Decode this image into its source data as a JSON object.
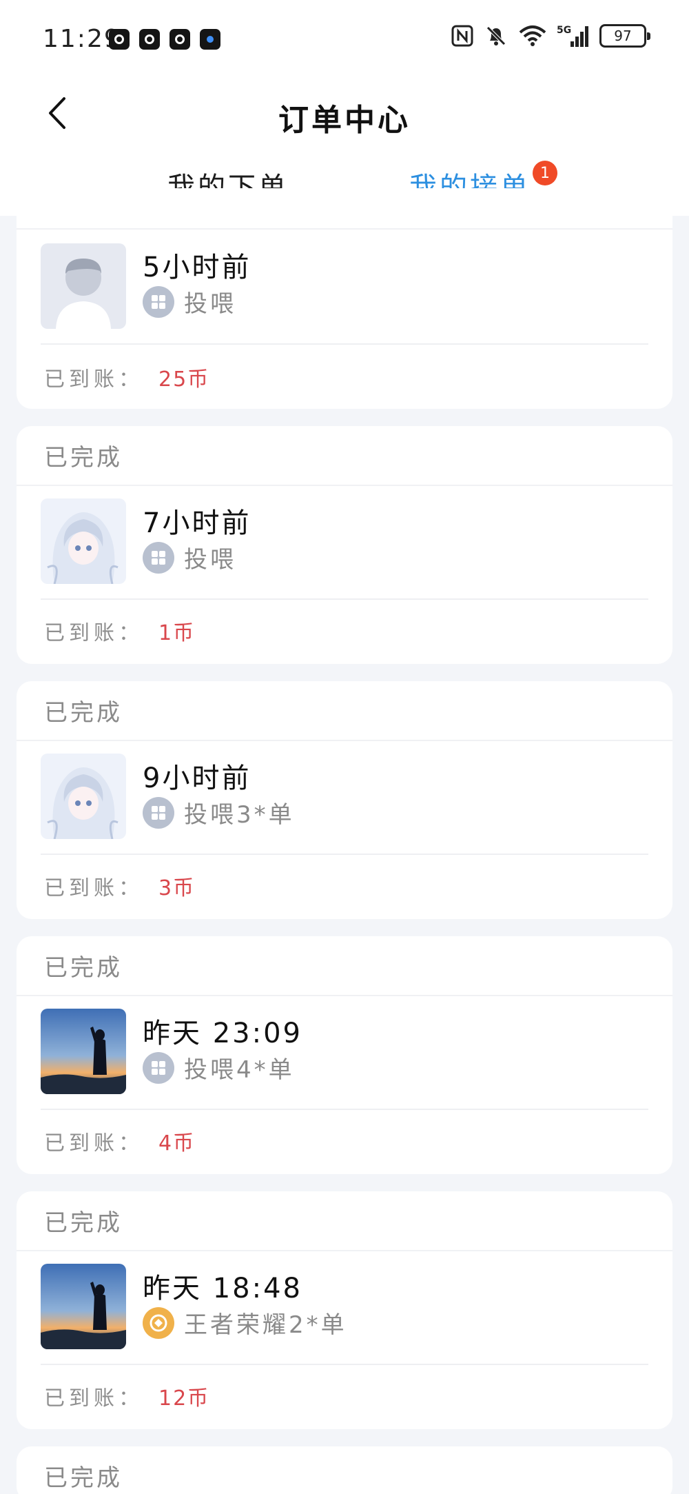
{
  "status_bar": {
    "time": "11:29",
    "battery": "97",
    "network": "5G"
  },
  "header": {
    "title": "订单中心"
  },
  "tabs": [
    {
      "label": "我的下单",
      "active": false
    },
    {
      "label": "我的接单",
      "active": true,
      "badge": "1"
    }
  ],
  "accent_color": "#2c8fe0",
  "amount_color": "#d9474c",
  "earning_label": "已到账：",
  "orders": [
    {
      "status": "",
      "time": "5小时前",
      "service": "投喂",
      "service_icon": "grid-icon",
      "avatar": "default-avatar",
      "amount": "25币"
    },
    {
      "status": "已完成",
      "time": "7小时前",
      "service": "投喂",
      "service_icon": "grid-icon",
      "avatar": "anime-avatar",
      "amount": "1币"
    },
    {
      "status": "已完成",
      "time": "9小时前",
      "service": "投喂3*单",
      "service_icon": "grid-icon",
      "avatar": "anime-avatar",
      "amount": "3币"
    },
    {
      "status": "已完成",
      "time": "昨天 23:09",
      "service": "投喂4*单",
      "service_icon": "grid-icon",
      "avatar": "sunset-avatar",
      "amount": "4币"
    },
    {
      "status": "已完成",
      "time": "昨天 18:48",
      "service": "王者荣耀2*单",
      "service_icon": "game-icon",
      "avatar": "sunset-avatar",
      "amount": "12币"
    },
    {
      "status": "已完成"
    }
  ]
}
